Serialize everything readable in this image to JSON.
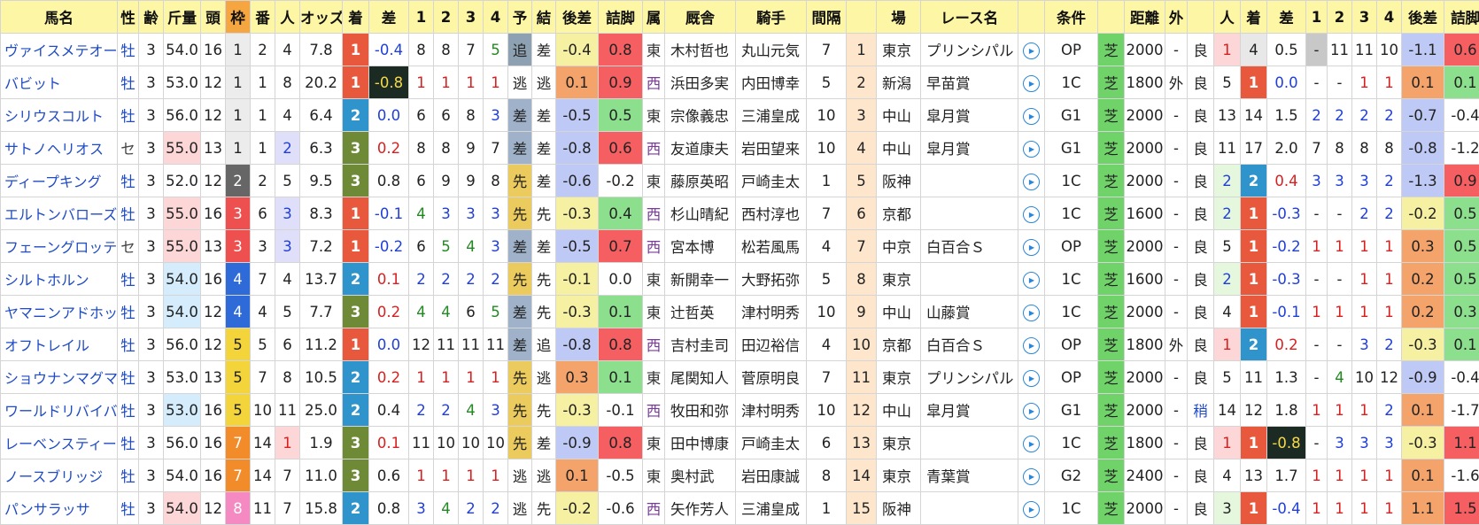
{
  "columns": [
    "馬名",
    "性",
    "齢",
    "斤量",
    "頭",
    "枠",
    "番",
    "人",
    "オッズ",
    "着",
    "差",
    "1",
    "2",
    "3",
    "4",
    "予",
    "結",
    "後差",
    "詰脚",
    "属",
    "厩舎",
    "騎手",
    "間隔",
    "",
    "場",
    "レース名",
    "",
    "条件",
    "",
    "距離",
    "外",
    "",
    "人",
    "着",
    "差",
    "1",
    "2",
    "3",
    "4",
    "後差",
    "詰脚"
  ],
  "col_widths": [
    132,
    24,
    28,
    42,
    28,
    28,
    28,
    28,
    48,
    30,
    45,
    28,
    28,
    28,
    28,
    27,
    27,
    48,
    50,
    25,
    80,
    80,
    45,
    34,
    50,
    110,
    30,
    60,
    30,
    46,
    25,
    30,
    30,
    30,
    44,
    24,
    28,
    28,
    28,
    48,
    48
  ],
  "rows": [
    {
      "name": "ヴァイスメテオール",
      "sex": "牡",
      "age": "3",
      "weight": "54.0",
      "heads": "16",
      "waku": "1",
      "ban": "2",
      "ninki": "4",
      "odds": "7.8",
      "chaku": "1",
      "sa": "-0.4",
      "c1": "8",
      "c2": "8",
      "c3": "7",
      "c4": "5",
      "yoso": "追",
      "kekka": "差",
      "atosa": "-0.4",
      "tsume": "0.8",
      "zoku": "東",
      "stable": "木村哲也",
      "jockey": "丸山元気",
      "interval": "7",
      "rn": "1",
      "venue": "東京",
      "race": "プリンシパル",
      "cond": "OP",
      "surface": "芝",
      "dist": "2000",
      "soto": "-",
      "baba": "良",
      "p_ninki": "1",
      "p_chaku": "4",
      "p_sa": "0.5",
      "p1": "-",
      "p2": "11",
      "p3": "11",
      "p4": "10",
      "p_atosa": "-1.1",
      "p_tsume": "0.6"
    },
    {
      "name": "バビット",
      "sex": "牡",
      "age": "3",
      "weight": "53.0",
      "heads": "12",
      "waku": "1",
      "ban": "1",
      "ninki": "8",
      "odds": "20.2",
      "chaku": "1",
      "sa": "-0.8",
      "c1": "1",
      "c2": "1",
      "c3": "1",
      "c4": "1",
      "yoso": "逃",
      "kekka": "逃",
      "atosa": "0.1",
      "tsume": "0.9",
      "zoku": "西",
      "stable": "浜田多実",
      "jockey": "内田博幸",
      "interval": "5",
      "rn": "2",
      "venue": "新潟",
      "race": "早苗賞",
      "cond": "1C",
      "surface": "芝",
      "dist": "1800",
      "soto": "外",
      "baba": "良",
      "p_ninki": "5",
      "p_chaku": "1",
      "p_sa": "0.0",
      "p1": "-",
      "p2": "-",
      "p3": "1",
      "p4": "1",
      "p_atosa": "0.1",
      "p_tsume": "0.1"
    },
    {
      "name": "シリウスコルト",
      "sex": "牡",
      "age": "3",
      "weight": "56.0",
      "heads": "12",
      "waku": "1",
      "ban": "1",
      "ninki": "4",
      "odds": "6.4",
      "chaku": "2",
      "sa": "0.0",
      "c1": "6",
      "c2": "6",
      "c3": "8",
      "c4": "3",
      "yoso": "差",
      "kekka": "差",
      "atosa": "-0.5",
      "tsume": "0.5",
      "zoku": "東",
      "stable": "宗像義忠",
      "jockey": "三浦皇成",
      "interval": "10",
      "rn": "3",
      "venue": "中山",
      "race": "皐月賞",
      "cond": "G1",
      "surface": "芝",
      "dist": "2000",
      "soto": "-",
      "baba": "良",
      "p_ninki": "13",
      "p_chaku": "14",
      "p_sa": "1.5",
      "p1": "2",
      "p2": "2",
      "p3": "2",
      "p4": "2",
      "p_atosa": "-0.7",
      "p_tsume": "-0.4"
    },
    {
      "name": "サトノヘリオス",
      "sex": "セ",
      "age": "3",
      "weight": "55.0",
      "heads": "13",
      "waku": "1",
      "ban": "1",
      "ninki": "2",
      "odds": "6.3",
      "chaku": "3",
      "sa": "0.2",
      "c1": "8",
      "c2": "8",
      "c3": "9",
      "c4": "7",
      "yoso": "差",
      "kekka": "差",
      "atosa": "-0.8",
      "tsume": "0.6",
      "zoku": "西",
      "stable": "友道康夫",
      "jockey": "岩田望来",
      "interval": "10",
      "rn": "4",
      "venue": "中山",
      "race": "皐月賞",
      "cond": "G1",
      "surface": "芝",
      "dist": "2000",
      "soto": "-",
      "baba": "良",
      "p_ninki": "11",
      "p_chaku": "17",
      "p_sa": "2.0",
      "p1": "7",
      "p2": "8",
      "p3": "8",
      "p4": "8",
      "p_atosa": "-0.8",
      "p_tsume": "-1.2"
    },
    {
      "name": "ディープキング",
      "sex": "牡",
      "age": "3",
      "weight": "52.0",
      "heads": "12",
      "waku": "2",
      "ban": "2",
      "ninki": "5",
      "odds": "9.5",
      "chaku": "3",
      "sa": "0.8",
      "c1": "6",
      "c2": "9",
      "c3": "9",
      "c4": "8",
      "yoso": "先",
      "kekka": "差",
      "atosa": "-0.6",
      "tsume": "-0.2",
      "zoku": "東",
      "stable": "藤原英昭",
      "jockey": "戸崎圭太",
      "interval": "1",
      "rn": "5",
      "venue": "阪神",
      "race": "",
      "cond": "1C",
      "surface": "芝",
      "dist": "2000",
      "soto": "-",
      "baba": "良",
      "p_ninki": "2",
      "p_chaku": "2",
      "p_sa": "0.4",
      "p1": "3",
      "p2": "3",
      "p3": "3",
      "p4": "2",
      "p_atosa": "-1.3",
      "p_tsume": "0.9"
    },
    {
      "name": "エルトンバローズ",
      "sex": "牡",
      "age": "3",
      "weight": "55.0",
      "heads": "16",
      "waku": "3",
      "ban": "6",
      "ninki": "3",
      "odds": "8.3",
      "chaku": "1",
      "sa": "-0.1",
      "c1": "4",
      "c2": "3",
      "c3": "3",
      "c4": "3",
      "yoso": "先",
      "kekka": "先",
      "atosa": "-0.3",
      "tsume": "0.4",
      "zoku": "西",
      "stable": "杉山晴紀",
      "jockey": "西村淳也",
      "interval": "7",
      "rn": "6",
      "venue": "京都",
      "race": "",
      "cond": "1C",
      "surface": "芝",
      "dist": "1600",
      "soto": "-",
      "baba": "良",
      "p_ninki": "2",
      "p_chaku": "1",
      "p_sa": "-0.3",
      "p1": "-",
      "p2": "-",
      "p3": "2",
      "p4": "2",
      "p_atosa": "-0.2",
      "p_tsume": "0.5"
    },
    {
      "name": "フェーングロッテン",
      "sex": "セ",
      "age": "3",
      "weight": "55.0",
      "heads": "13",
      "waku": "3",
      "ban": "3",
      "ninki": "3",
      "odds": "7.2",
      "chaku": "1",
      "sa": "-0.2",
      "c1": "6",
      "c2": "5",
      "c3": "4",
      "c4": "3",
      "yoso": "差",
      "kekka": "差",
      "atosa": "-0.5",
      "tsume": "0.7",
      "zoku": "西",
      "stable": "宮本博",
      "jockey": "松若風馬",
      "interval": "4",
      "rn": "7",
      "venue": "中京",
      "race": "白百合Ｓ",
      "cond": "OP",
      "surface": "芝",
      "dist": "2000",
      "soto": "-",
      "baba": "良",
      "p_ninki": "5",
      "p_chaku": "1",
      "p_sa": "-0.2",
      "p1": "1",
      "p2": "1",
      "p3": "1",
      "p4": "1",
      "p_atosa": "0.3",
      "p_tsume": "0.5"
    },
    {
      "name": "シルトホルン",
      "sex": "牡",
      "age": "3",
      "weight": "54.0",
      "heads": "16",
      "waku": "4",
      "ban": "7",
      "ninki": "4",
      "odds": "13.7",
      "chaku": "2",
      "sa": "0.1",
      "c1": "2",
      "c2": "2",
      "c3": "2",
      "c4": "2",
      "yoso": "先",
      "kekka": "先",
      "atosa": "-0.1",
      "tsume": "0.0",
      "zoku": "東",
      "stable": "新開幸一",
      "jockey": "大野拓弥",
      "interval": "5",
      "rn": "8",
      "venue": "東京",
      "race": "",
      "cond": "1C",
      "surface": "芝",
      "dist": "1600",
      "soto": "-",
      "baba": "良",
      "p_ninki": "2",
      "p_chaku": "1",
      "p_sa": "-0.3",
      "p1": "-",
      "p2": "-",
      "p3": "1",
      "p4": "1",
      "p_atosa": "0.2",
      "p_tsume": "0.5"
    },
    {
      "name": "ヤマニンアドホック",
      "sex": "牡",
      "age": "3",
      "weight": "54.0",
      "heads": "12",
      "waku": "4",
      "ban": "4",
      "ninki": "5",
      "odds": "7.7",
      "chaku": "3",
      "sa": "0.2",
      "c1": "4",
      "c2": "4",
      "c3": "6",
      "c4": "5",
      "yoso": "差",
      "kekka": "先",
      "atosa": "-0.3",
      "tsume": "0.1",
      "zoku": "東",
      "stable": "辻哲英",
      "jockey": "津村明秀",
      "interval": "10",
      "rn": "9",
      "venue": "中山",
      "race": "山藤賞",
      "cond": "1C",
      "surface": "芝",
      "dist": "2000",
      "soto": "-",
      "baba": "良",
      "p_ninki": "4",
      "p_chaku": "1",
      "p_sa": "-0.1",
      "p1": "1",
      "p2": "1",
      "p3": "1",
      "p4": "1",
      "p_atosa": "0.2",
      "p_tsume": "0.3"
    },
    {
      "name": "オフトレイル",
      "sex": "牡",
      "age": "3",
      "weight": "56.0",
      "heads": "12",
      "waku": "5",
      "ban": "5",
      "ninki": "6",
      "odds": "11.2",
      "chaku": "1",
      "sa": "0.0",
      "c1": "12",
      "c2": "11",
      "c3": "11",
      "c4": "11",
      "yoso": "差",
      "kekka": "追",
      "atosa": "-0.8",
      "tsume": "0.8",
      "zoku": "西",
      "stable": "吉村圭司",
      "jockey": "田辺裕信",
      "interval": "4",
      "rn": "10",
      "venue": "京都",
      "race": "白百合Ｓ",
      "cond": "OP",
      "surface": "芝",
      "dist": "1800",
      "soto": "外",
      "baba": "良",
      "p_ninki": "1",
      "p_chaku": "2",
      "p_sa": "0.2",
      "p1": "-",
      "p2": "-",
      "p3": "3",
      "p4": "2",
      "p_atosa": "-0.3",
      "p_tsume": "0.1"
    },
    {
      "name": "ショウナンマグマ",
      "sex": "牡",
      "age": "3",
      "weight": "53.0",
      "heads": "13",
      "waku": "5",
      "ban": "7",
      "ninki": "8",
      "odds": "10.5",
      "chaku": "2",
      "sa": "0.2",
      "c1": "1",
      "c2": "1",
      "c3": "1",
      "c4": "1",
      "yoso": "先",
      "kekka": "逃",
      "atosa": "0.3",
      "tsume": "0.1",
      "zoku": "東",
      "stable": "尾関知人",
      "jockey": "菅原明良",
      "interval": "7",
      "rn": "11",
      "venue": "東京",
      "race": "プリンシパル",
      "cond": "OP",
      "surface": "芝",
      "dist": "2000",
      "soto": "-",
      "baba": "良",
      "p_ninki": "5",
      "p_chaku": "11",
      "p_sa": "1.3",
      "p1": "-",
      "p2": "4",
      "p3": "10",
      "p4": "12",
      "p_atosa": "-0.9",
      "p_tsume": "-0.4"
    },
    {
      "name": "ワールドリバイバル",
      "sex": "牡",
      "age": "3",
      "weight": "53.0",
      "heads": "16",
      "waku": "5",
      "ban": "10",
      "ninki": "11",
      "odds": "25.0",
      "chaku": "2",
      "sa": "0.4",
      "c1": "2",
      "c2": "2",
      "c3": "4",
      "c4": "3",
      "yoso": "先",
      "kekka": "先",
      "atosa": "-0.3",
      "tsume": "-0.1",
      "zoku": "西",
      "stable": "牧田和弥",
      "jockey": "津村明秀",
      "interval": "10",
      "rn": "12",
      "venue": "中山",
      "race": "皐月賞",
      "cond": "G1",
      "surface": "芝",
      "dist": "2000",
      "soto": "-",
      "baba": "稍",
      "p_ninki": "14",
      "p_chaku": "12",
      "p_sa": "1.8",
      "p1": "1",
      "p2": "1",
      "p3": "1",
      "p4": "2",
      "p_atosa": "0.1",
      "p_tsume": "-1.7"
    },
    {
      "name": "レーベンスティール",
      "sex": "牡",
      "age": "3",
      "weight": "56.0",
      "heads": "16",
      "waku": "7",
      "ban": "14",
      "ninki": "1",
      "odds": "1.9",
      "chaku": "3",
      "sa": "0.1",
      "c1": "11",
      "c2": "10",
      "c3": "10",
      "c4": "10",
      "yoso": "先",
      "kekka": "差",
      "atosa": "-0.9",
      "tsume": "0.8",
      "zoku": "東",
      "stable": "田中博康",
      "jockey": "戸崎圭太",
      "interval": "6",
      "rn": "13",
      "venue": "東京",
      "race": "",
      "cond": "1C",
      "surface": "芝",
      "dist": "1800",
      "soto": "-",
      "baba": "良",
      "p_ninki": "1",
      "p_chaku": "1",
      "p_sa": "-0.8",
      "p1": "-",
      "p2": "3",
      "p3": "3",
      "p4": "3",
      "p_atosa": "-0.3",
      "p_tsume": "1.1"
    },
    {
      "name": "ノースブリッジ",
      "sex": "牡",
      "age": "3",
      "weight": "54.0",
      "heads": "16",
      "waku": "7",
      "ban": "14",
      "ninki": "7",
      "odds": "11.0",
      "chaku": "3",
      "sa": "0.6",
      "c1": "1",
      "c2": "1",
      "c3": "1",
      "c4": "1",
      "yoso": "逃",
      "kekka": "逃",
      "atosa": "0.1",
      "tsume": "-0.5",
      "zoku": "東",
      "stable": "奥村武",
      "jockey": "岩田康誠",
      "interval": "8",
      "rn": "14",
      "venue": "東京",
      "race": "青葉賞",
      "cond": "G2",
      "surface": "芝",
      "dist": "2400",
      "soto": "-",
      "baba": "良",
      "p_ninki": "4",
      "p_chaku": "13",
      "p_sa": "1.7",
      "p1": "1",
      "p2": "1",
      "p3": "1",
      "p4": "1",
      "p_atosa": "0.1",
      "p_tsume": "-1.6"
    },
    {
      "name": "パンサラッサ",
      "sex": "牡",
      "age": "3",
      "weight": "54.0",
      "heads": "12",
      "waku": "8",
      "ban": "11",
      "ninki": "7",
      "odds": "15.8",
      "chaku": "2",
      "sa": "0.8",
      "c1": "3",
      "c2": "4",
      "c3": "2",
      "c4": "2",
      "yoso": "逃",
      "kekka": "先",
      "atosa": "-0.2",
      "tsume": "-0.6",
      "zoku": "西",
      "stable": "矢作芳人",
      "jockey": "三浦皇成",
      "interval": "1",
      "rn": "15",
      "venue": "阪神",
      "race": "",
      "cond": "1C",
      "surface": "芝",
      "dist": "2000",
      "soto": "-",
      "baba": "良",
      "p_ninki": "3",
      "p_chaku": "1",
      "p_sa": "-0.4",
      "p1": "1",
      "p2": "1",
      "p3": "1",
      "p4": "1",
      "p_atosa": "1.1",
      "p_tsume": "1.5"
    }
  ],
  "colors": {
    "header_bg": "#fdf6a5",
    "waku": {
      "1": "#ececec",
      "2": "#666666",
      "3": "#ee4f4f",
      "4": "#2f6bd8",
      "5": "#f3d43b",
      "6": "#45a849",
      "7": "#f28c2b",
      "8": "#f58ac2"
    },
    "waku_text": {
      "1": "#222222",
      "2": "#ffffff",
      "3": "#ffffff",
      "4": "#ffffff",
      "5": "#222222",
      "6": "#ffffff",
      "7": "#ffffff",
      "8": "#ffffff"
    },
    "chaku": {
      "1": "#e8583c",
      "2": "#2f94cc",
      "3": "#6e8a36"
    },
    "style": {
      "逃": "#ffffff",
      "先": "#eccb5e",
      "差": "#9fb2c9",
      "追": "#8da1b2"
    },
    "surface": "#70d36a",
    "rn_bg": "#fde6cc",
    "weight_pink": "#fdd7d7",
    "weight_blue": "#d4ecfb",
    "ninki_pink": "#fdd7d7",
    "ninki_lav": "#dfdff9",
    "black": "#1b2b24",
    "gray": "#c8c8c8",
    "tsume": {
      "hi": "#f65f62",
      "mid": "#8ce08d",
      "lo": "#f8f8f8"
    },
    "atosa": {
      "pos": "#f4a36a",
      "neg": "#bfc9f6",
      "zero": "#f5f0a2"
    }
  },
  "icons": {
    "play": "play-circle-icon"
  }
}
